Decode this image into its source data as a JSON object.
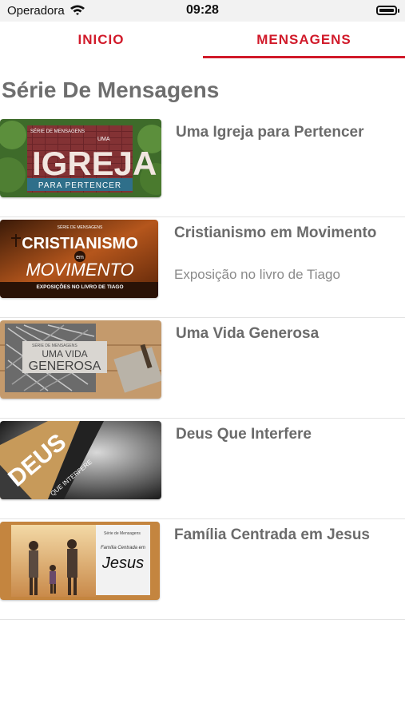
{
  "status_bar": {
    "carrier": "Operadora",
    "time": "09:28"
  },
  "tabs": [
    {
      "label": "INICIO",
      "active": false
    },
    {
      "label": "MENSAGENS",
      "active": true
    }
  ],
  "accent_color": "#d11a2a",
  "section_title": "Série De Mensagens",
  "series": [
    {
      "title": "Uma Igreja para Pertencer",
      "subtitle": "",
      "thumb": {
        "top": "SÉRIE DE MENSAGENS",
        "small": "UMA",
        "big": "IGREJA",
        "bottom": "PARA PERTENCER"
      }
    },
    {
      "title": "Cristianismo em Movimento",
      "subtitle": "Exposição no livro de Tiago",
      "thumb": {
        "top": "SÉRIE DE MENSAGENS",
        "big1": "CRISTIANISMO",
        "small": "em",
        "big2": "MOVIMENTO",
        "bottom": "EXPOSIÇÕES NO LIVRO DE TIAGO"
      }
    },
    {
      "title": "Uma Vida Generosa",
      "subtitle": "",
      "thumb": {
        "top": "SÉRIE DE MENSAGENS",
        "line1": "UMA VIDA",
        "line2": "GENEROSA"
      }
    },
    {
      "title": "Deus Que Interfere",
      "subtitle": "",
      "thumb": {
        "big": "DEUS",
        "small": "QUE INTERFERE"
      }
    },
    {
      "title": "Família Centrada em Jesus",
      "subtitle": "",
      "thumb": {
        "top": "Série de Mensagens",
        "line1": "Família Centrada em",
        "line2": "Jesus"
      }
    }
  ]
}
